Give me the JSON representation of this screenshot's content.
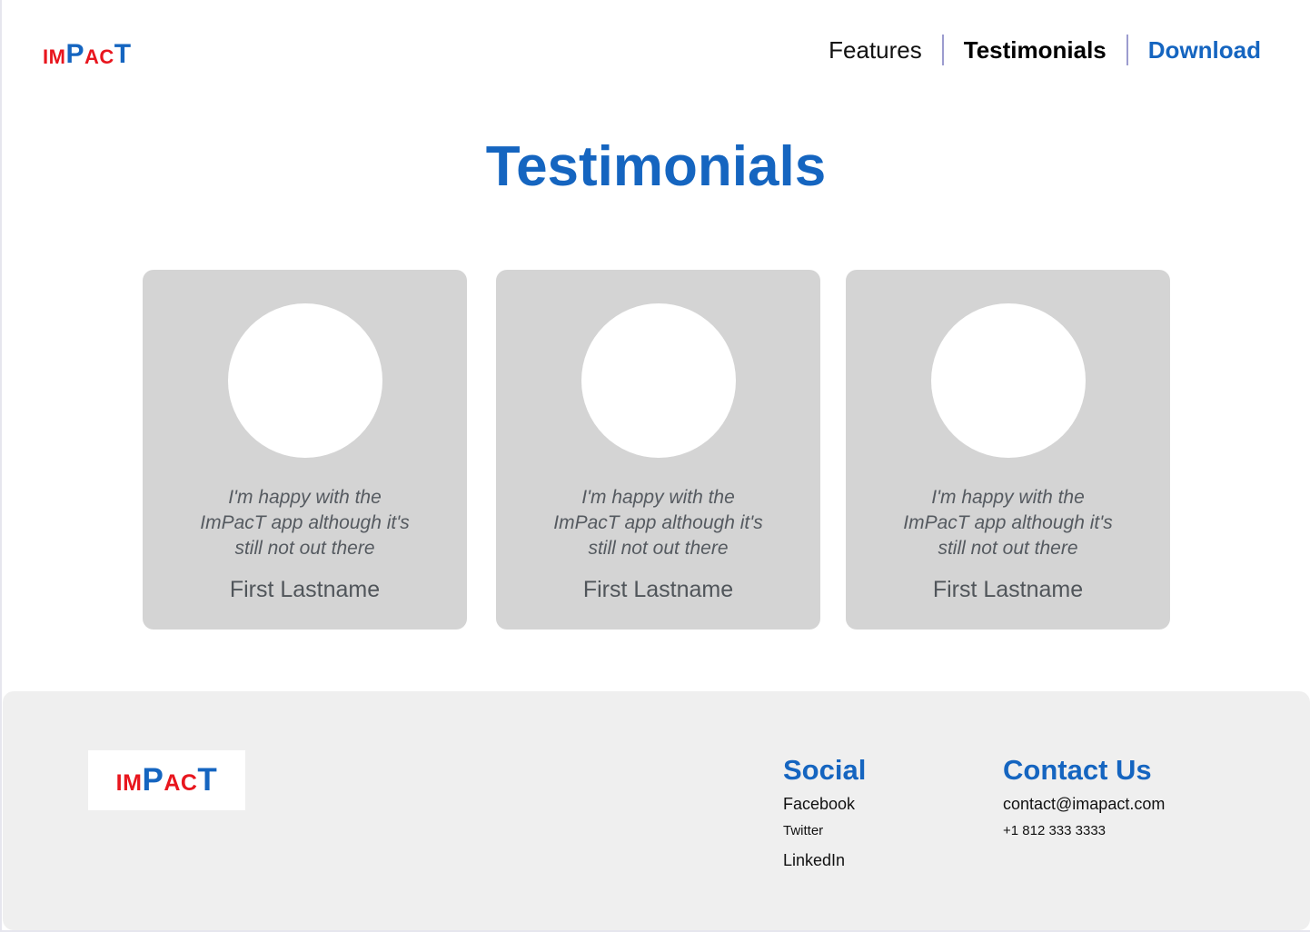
{
  "brand": {
    "logo_parts": [
      {
        "text": "IM",
        "color": "#e8161e",
        "size": "sm"
      },
      {
        "text": "P",
        "color": "#1565c0",
        "size": "lg"
      },
      {
        "text": "AC",
        "color": "#e8161e",
        "size": "sm"
      },
      {
        "text": "T",
        "color": "#1565c0",
        "size": "lg"
      }
    ],
    "accent_color": "#1565c0",
    "red_color": "#e8161e"
  },
  "nav": {
    "features": "Features",
    "testimonials": "Testimonials",
    "download": "Download"
  },
  "page_title": "Testimonials",
  "testimonials": [
    {
      "quote_lines": [
        "I'm happy with the",
        "ImPacT app although it's",
        "still not out there"
      ],
      "name": "First Lastname"
    },
    {
      "quote_lines": [
        "I'm happy with the",
        "ImPacT app although it's",
        "still not out there"
      ],
      "name": "First Lastname"
    },
    {
      "quote_lines": [
        "I'm happy with the",
        "ImPacT app although it's",
        "still not out there"
      ],
      "name": "First Lastname"
    }
  ],
  "footer": {
    "social": {
      "heading": "Social",
      "links": [
        "Facebook",
        "Twitter",
        "LinkedIn"
      ]
    },
    "contact": {
      "heading": "Contact Us",
      "email": "contact@imapact.com",
      "phone": "+1 812 333 3333"
    }
  }
}
